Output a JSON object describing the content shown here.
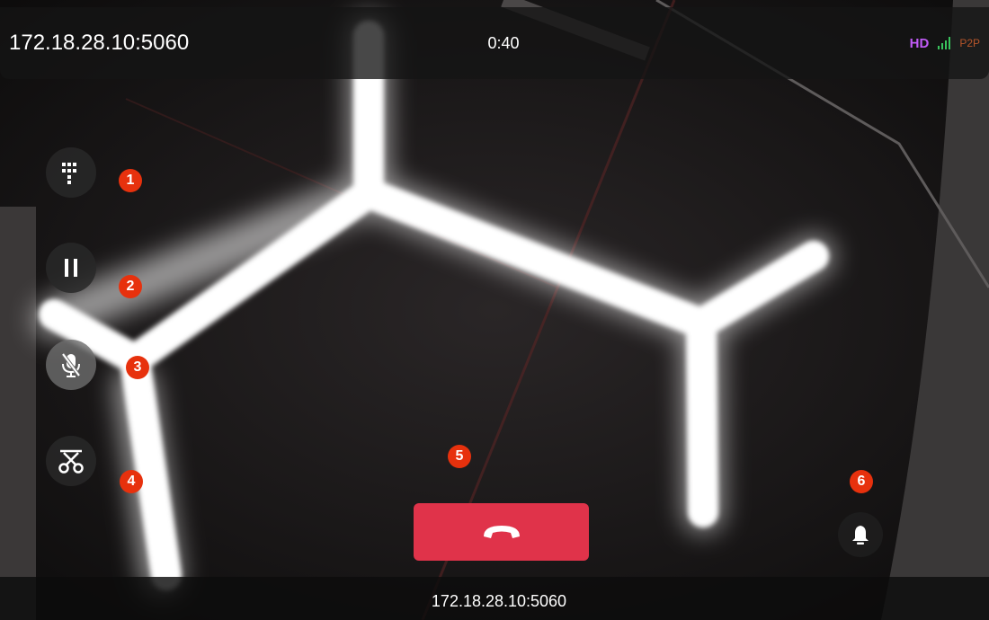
{
  "header": {
    "address": "172.18.28.10:5060",
    "timer": "0:40",
    "quality_badge": "HD",
    "signal_icon": "signal-bars-icon",
    "connection_badge": "P2P"
  },
  "controls": [
    {
      "icon": "dialpad-icon",
      "marker": "1"
    },
    {
      "icon": "pause-icon",
      "marker": "2"
    },
    {
      "icon": "mic-off-icon",
      "marker": "3"
    },
    {
      "icon": "scissors-transfer-icon",
      "marker": "4"
    }
  ],
  "hangup": {
    "icon": "phone-hangup-icon",
    "marker": "5"
  },
  "alarm": {
    "icon": "bell-icon",
    "marker": "6"
  },
  "footer": {
    "address": "172.18.28.10:5060"
  },
  "colors": {
    "hangup": "#e0334a",
    "marker": "#e7310d",
    "hd": "#c15bf7",
    "signal": "#39c35c",
    "p2p": "#b6552a"
  }
}
